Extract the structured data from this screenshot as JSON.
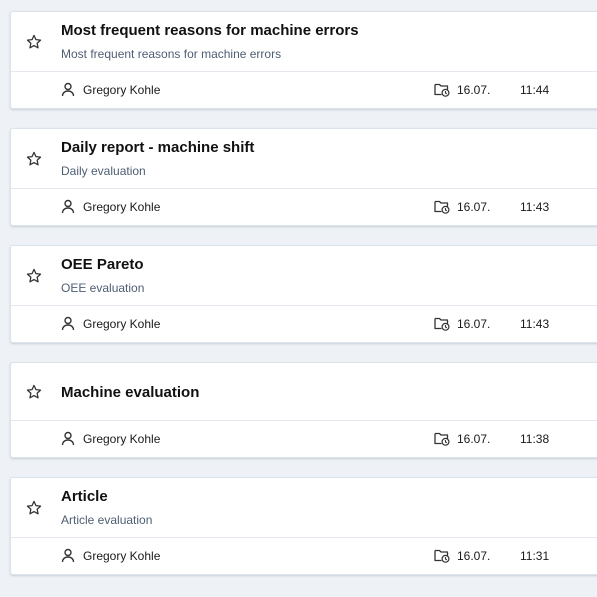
{
  "reports": [
    {
      "title": "Most frequent reasons for machine errors",
      "subtitle": "Most frequent reasons for machine errors",
      "author": "Gregory Kohle",
      "date": "16.07.",
      "time": "11:44",
      "favorite": false
    },
    {
      "title": "Daily report - machine shift",
      "subtitle": "Daily evaluation",
      "author": "Gregory Kohle",
      "date": "16.07.",
      "time": "11:43",
      "favorite": false
    },
    {
      "title": "OEE Pareto",
      "subtitle": "OEE evaluation",
      "author": "Gregory Kohle",
      "date": "16.07.",
      "time": "11:43",
      "favorite": false
    },
    {
      "title": "Machine evaluation",
      "subtitle": "",
      "author": "Gregory Kohle",
      "date": "16.07.",
      "time": "11:38",
      "favorite": false
    },
    {
      "title": "Article",
      "subtitle": "Article evaluation",
      "author": "Gregory Kohle",
      "date": "16.07.",
      "time": "11:31",
      "favorite": false
    }
  ],
  "icons": {
    "favorite": "star-outline-icon",
    "author": "user-icon",
    "date": "folder-clock-icon"
  },
  "colors": {
    "background": "#eef2f7",
    "card": "#ffffff",
    "title": "#111111",
    "subtitle": "#4e5e73",
    "icon": "#333333"
  }
}
